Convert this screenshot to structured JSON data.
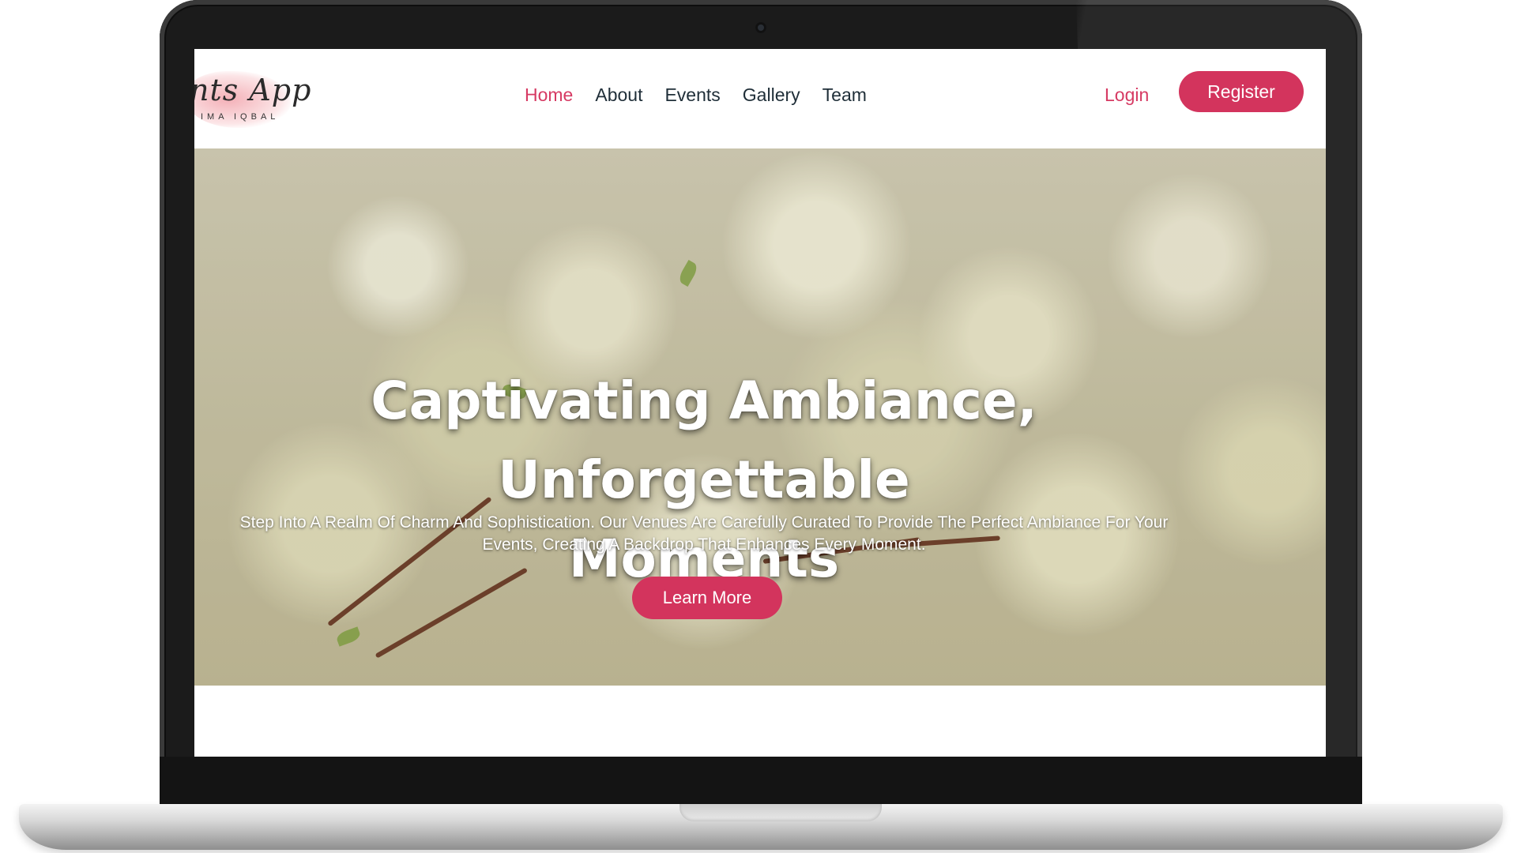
{
  "brand": {
    "logo_text": "nts App",
    "logo_subtext": "IMA IQBAL"
  },
  "nav": {
    "items": [
      {
        "label": "Home",
        "active": true
      },
      {
        "label": "About",
        "active": false
      },
      {
        "label": "Events",
        "active": false
      },
      {
        "label": "Gallery",
        "active": false
      },
      {
        "label": "Team",
        "active": false
      }
    ],
    "login_label": "Login",
    "register_label": "Register"
  },
  "hero": {
    "title_line1": "Captivating Ambiance, Unforgettable",
    "title_line2": "Moments",
    "subtitle_line1": "Step Into A Realm Of Charm And Sophistication. Our Venues Are Carefully Curated To Provide The Perfect Ambiance For Your",
    "subtitle_line2": "Events, Creating A Backdrop That Enhances Every Moment.",
    "cta_label": "Learn More"
  },
  "colors": {
    "accent": "#d3345d",
    "nav_text": "#1f2e38"
  }
}
